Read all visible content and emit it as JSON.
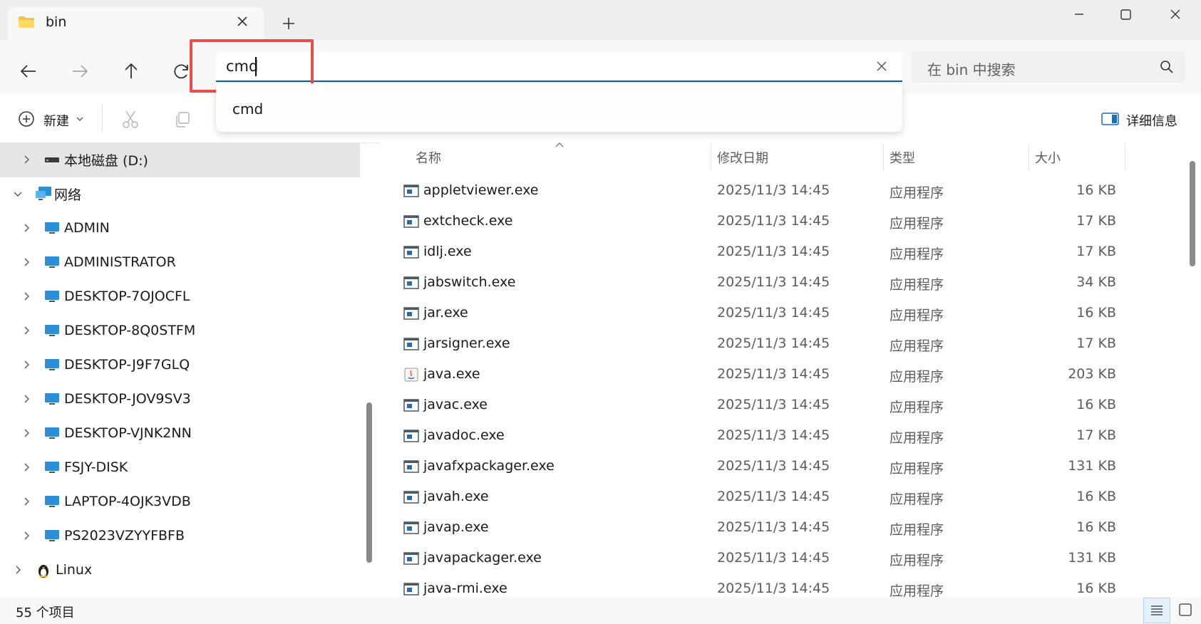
{
  "tab": {
    "title": "bin",
    "close_icon": "close-icon",
    "new_tab_icon": "plus-icon"
  },
  "window": {
    "minimize_icon": "minimize-icon",
    "maximize_icon": "maximize-icon",
    "close_icon": "close-icon"
  },
  "address": {
    "value": "cmd"
  },
  "search": {
    "placeholder": "在 bin 中搜索"
  },
  "suggestion": {
    "item": "cmd"
  },
  "toolbar": {
    "new_label": "新建",
    "details_label": "详细信息"
  },
  "sidebar": {
    "selected": {
      "label": "本地磁盘 (D:)"
    },
    "network": {
      "label": "网络"
    },
    "computers": [
      "ADMIN",
      "ADMINISTRATOR",
      "DESKTOP-7OJOCFL",
      "DESKTOP-8Q0STFM",
      "DESKTOP-J9F7GLQ",
      "DESKTOP-JOV9SV3",
      "DESKTOP-VJNK2NN",
      "FSJY-DISK",
      "LAPTOP-4OJK3VDB",
      "PS2023VZYYFBFB"
    ],
    "linux": {
      "label": "Linux"
    }
  },
  "columns": {
    "name": "名称",
    "date": "修改日期",
    "type": "类型",
    "size": "大小"
  },
  "files": [
    {
      "name": "appletviewer.exe",
      "date": "2025/11/3 14:45",
      "type": "应用程序",
      "size": "16 KB",
      "icon": "exe-icon"
    },
    {
      "name": "extcheck.exe",
      "date": "2025/11/3 14:45",
      "type": "应用程序",
      "size": "17 KB",
      "icon": "exe-icon"
    },
    {
      "name": "idlj.exe",
      "date": "2025/11/3 14:45",
      "type": "应用程序",
      "size": "17 KB",
      "icon": "exe-icon"
    },
    {
      "name": "jabswitch.exe",
      "date": "2025/11/3 14:45",
      "type": "应用程序",
      "size": "34 KB",
      "icon": "exe-icon"
    },
    {
      "name": "jar.exe",
      "date": "2025/11/3 14:45",
      "type": "应用程序",
      "size": "16 KB",
      "icon": "exe-icon"
    },
    {
      "name": "jarsigner.exe",
      "date": "2025/11/3 14:45",
      "type": "应用程序",
      "size": "17 KB",
      "icon": "exe-icon"
    },
    {
      "name": "java.exe",
      "date": "2025/11/3 14:45",
      "type": "应用程序",
      "size": "203 KB",
      "icon": "java-icon"
    },
    {
      "name": "javac.exe",
      "date": "2025/11/3 14:45",
      "type": "应用程序",
      "size": "16 KB",
      "icon": "exe-icon"
    },
    {
      "name": "javadoc.exe",
      "date": "2025/11/3 14:45",
      "type": "应用程序",
      "size": "17 KB",
      "icon": "exe-icon"
    },
    {
      "name": "javafxpackager.exe",
      "date": "2025/11/3 14:45",
      "type": "应用程序",
      "size": "131 KB",
      "icon": "exe-icon"
    },
    {
      "name": "javah.exe",
      "date": "2025/11/3 14:45",
      "type": "应用程序",
      "size": "16 KB",
      "icon": "exe-icon"
    },
    {
      "name": "javap.exe",
      "date": "2025/11/3 14:45",
      "type": "应用程序",
      "size": "16 KB",
      "icon": "exe-icon"
    },
    {
      "name": "javapackager.exe",
      "date": "2025/11/3 14:45",
      "type": "应用程序",
      "size": "131 KB",
      "icon": "exe-icon"
    },
    {
      "name": "java-rmi.exe",
      "date": "2025/11/3 14:45",
      "type": "应用程序",
      "size": "16 KB",
      "icon": "exe-icon"
    }
  ],
  "status": {
    "count": "55 个项目"
  },
  "colors": {
    "accent": "#005fb8",
    "highlight": "#e94d4d",
    "selected_bg": "#e5e5e5"
  }
}
